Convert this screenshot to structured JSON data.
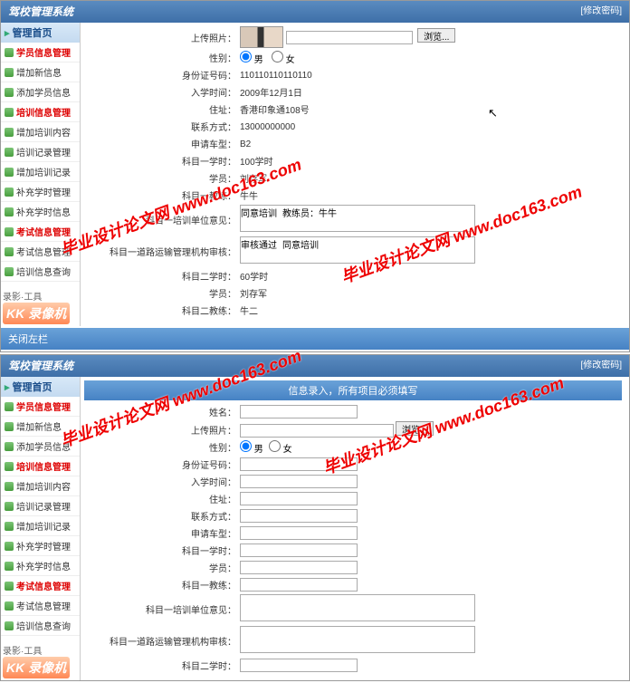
{
  "header": {
    "title": "驾校管理系统",
    "right": "[修改密码]"
  },
  "sidebar": {
    "head": "管理首页",
    "items": [
      {
        "label": "学员信息管理",
        "red": true
      },
      {
        "label": "增加新信息",
        "red": false
      },
      {
        "label": "添加学员信息",
        "red": false
      },
      {
        "label": "培训信息管理",
        "red": true
      },
      {
        "label": "增加培训内容",
        "red": false
      },
      {
        "label": "培训记录管理",
        "red": false
      },
      {
        "label": "增加培训记录",
        "red": false
      },
      {
        "label": "补充学时管理",
        "red": false
      },
      {
        "label": "补充学时信息",
        "red": false
      },
      {
        "label": "考试信息管理",
        "red": true
      },
      {
        "label": "考试信息管理",
        "red": false
      },
      {
        "label": "培训信息查询",
        "red": false
      }
    ],
    "kk_top": "录影·工具",
    "kk_main": "KK 录像机"
  },
  "top_form": {
    "photo_label": "上传照片：",
    "browse": "浏览...",
    "gender_label": "性别：",
    "gender_male": "男",
    "gender_female": "女",
    "id_label": "身份证号码：",
    "id_value": "110110110110110",
    "enroll_label": "入学时间：",
    "enroll_value": "2009年12月1日",
    "addr_label": "住址：",
    "addr_value": "香港印象通108号",
    "contact_label": "联系方式：",
    "contact_value": "13000000000",
    "cartype_label": "申请车型：",
    "cartype_value": "B2",
    "s1hours_label": "科目一学时：",
    "s1hours_value": "100学时",
    "student_label": "学员：",
    "student_value": "刘存军",
    "s1coach_label": "科目一教练：",
    "s1coach_value": "牛牛",
    "s1opinion_label": "科目一培训单位意见：",
    "s1opinion_value": "同意培训 教练员：牛牛",
    "s1review_label": "科目一道路运输管理机构审核：",
    "s1review_value": "审核通过 同意培训",
    "s2hours_label": "科目二学时：",
    "s2hours_value": "60学时",
    "student2_label": "学员：",
    "student2_value": "刘存军",
    "s2coach_label": "科目二教练：",
    "s2coach_value": "牛二"
  },
  "separator": "关闭左栏",
  "bottom_form": {
    "notice": "信息录入，所有项目必须填写",
    "name_label": "姓名：",
    "photo_label": "上传照片：",
    "browse": "浏览...",
    "gender_label": "性别：",
    "gender_male": "男",
    "gender_female": "女",
    "id_label": "身份证号码：",
    "enroll_label": "入学时间：",
    "addr_label": "住址：",
    "contact_label": "联系方式：",
    "cartype_label": "申请车型：",
    "s1hours_label": "科目一学时：",
    "student_label": "学员：",
    "s1coach_label": "科目一教练：",
    "s1opinion_label": "科目一培训单位意见：",
    "s1review_label": "科目一道路运输管理机构审核：",
    "s2hours_label": "科目二学时："
  },
  "watermark": "毕业设计论文网   www.doc163.com"
}
